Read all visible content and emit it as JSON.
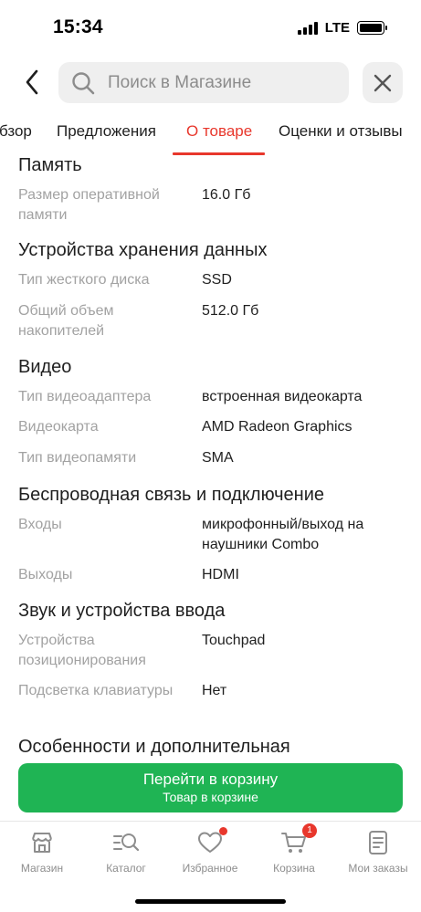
{
  "status_bar": {
    "time": "15:34",
    "network": "LTE"
  },
  "search": {
    "placeholder": "Поиск в Магазине"
  },
  "tabs": [
    {
      "label": "бзор",
      "active": false
    },
    {
      "label": "Предложения",
      "active": false
    },
    {
      "label": "О товаре",
      "active": true
    },
    {
      "label": "Оценки и отзывы",
      "active": false
    }
  ],
  "sections": {
    "memory": {
      "title": "Память",
      "specs": [
        {
          "label": "Размер оперативной памяти",
          "value": "16.0 Гб"
        }
      ]
    },
    "storage": {
      "title": "Устройства хранения данных",
      "specs": [
        {
          "label": "Тип жесткого диска",
          "value": "SSD"
        },
        {
          "label": "Общий объем накопителей",
          "value": "512.0 Гб"
        }
      ]
    },
    "video": {
      "title": "Видео",
      "specs": [
        {
          "label": "Тип видеоадаптера",
          "value": "встроенная видеокарта"
        },
        {
          "label": "Видеокарта",
          "value": "AMD Radeon Graphics"
        },
        {
          "label": "Тип видеопамяти",
          "value": "SMA"
        }
      ]
    },
    "wireless": {
      "title": "Беспроводная связь и подключение",
      "specs": [
        {
          "label": "Входы",
          "value": "микрофонный/выход на наушники Combo"
        },
        {
          "label": "Выходы",
          "value": "HDMI"
        }
      ]
    },
    "sound": {
      "title": "Звук и устройства ввода",
      "specs": [
        {
          "label": "Устройства позиционирования",
          "value": "Touchpad"
        },
        {
          "label": "Подсветка клавиатуры",
          "value": "Нет"
        }
      ]
    },
    "extra": {
      "title": "Особенности и дополнительная"
    }
  },
  "cart_banner": {
    "title": "Перейти в корзину",
    "subtitle": "Товар в корзине"
  },
  "bottom_nav": [
    {
      "label": "Магазин",
      "icon": "store-icon"
    },
    {
      "label": "Каталог",
      "icon": "catalog-search-icon"
    },
    {
      "label": "Избранное",
      "icon": "heart-icon",
      "dot": true
    },
    {
      "label": "Корзина",
      "icon": "cart-icon",
      "badge": "1"
    },
    {
      "label": "Мои заказы",
      "icon": "orders-icon"
    }
  ],
  "colors": {
    "accent": "#e8372c",
    "green": "#1fb454",
    "label_gray": "#a2a2a2"
  }
}
